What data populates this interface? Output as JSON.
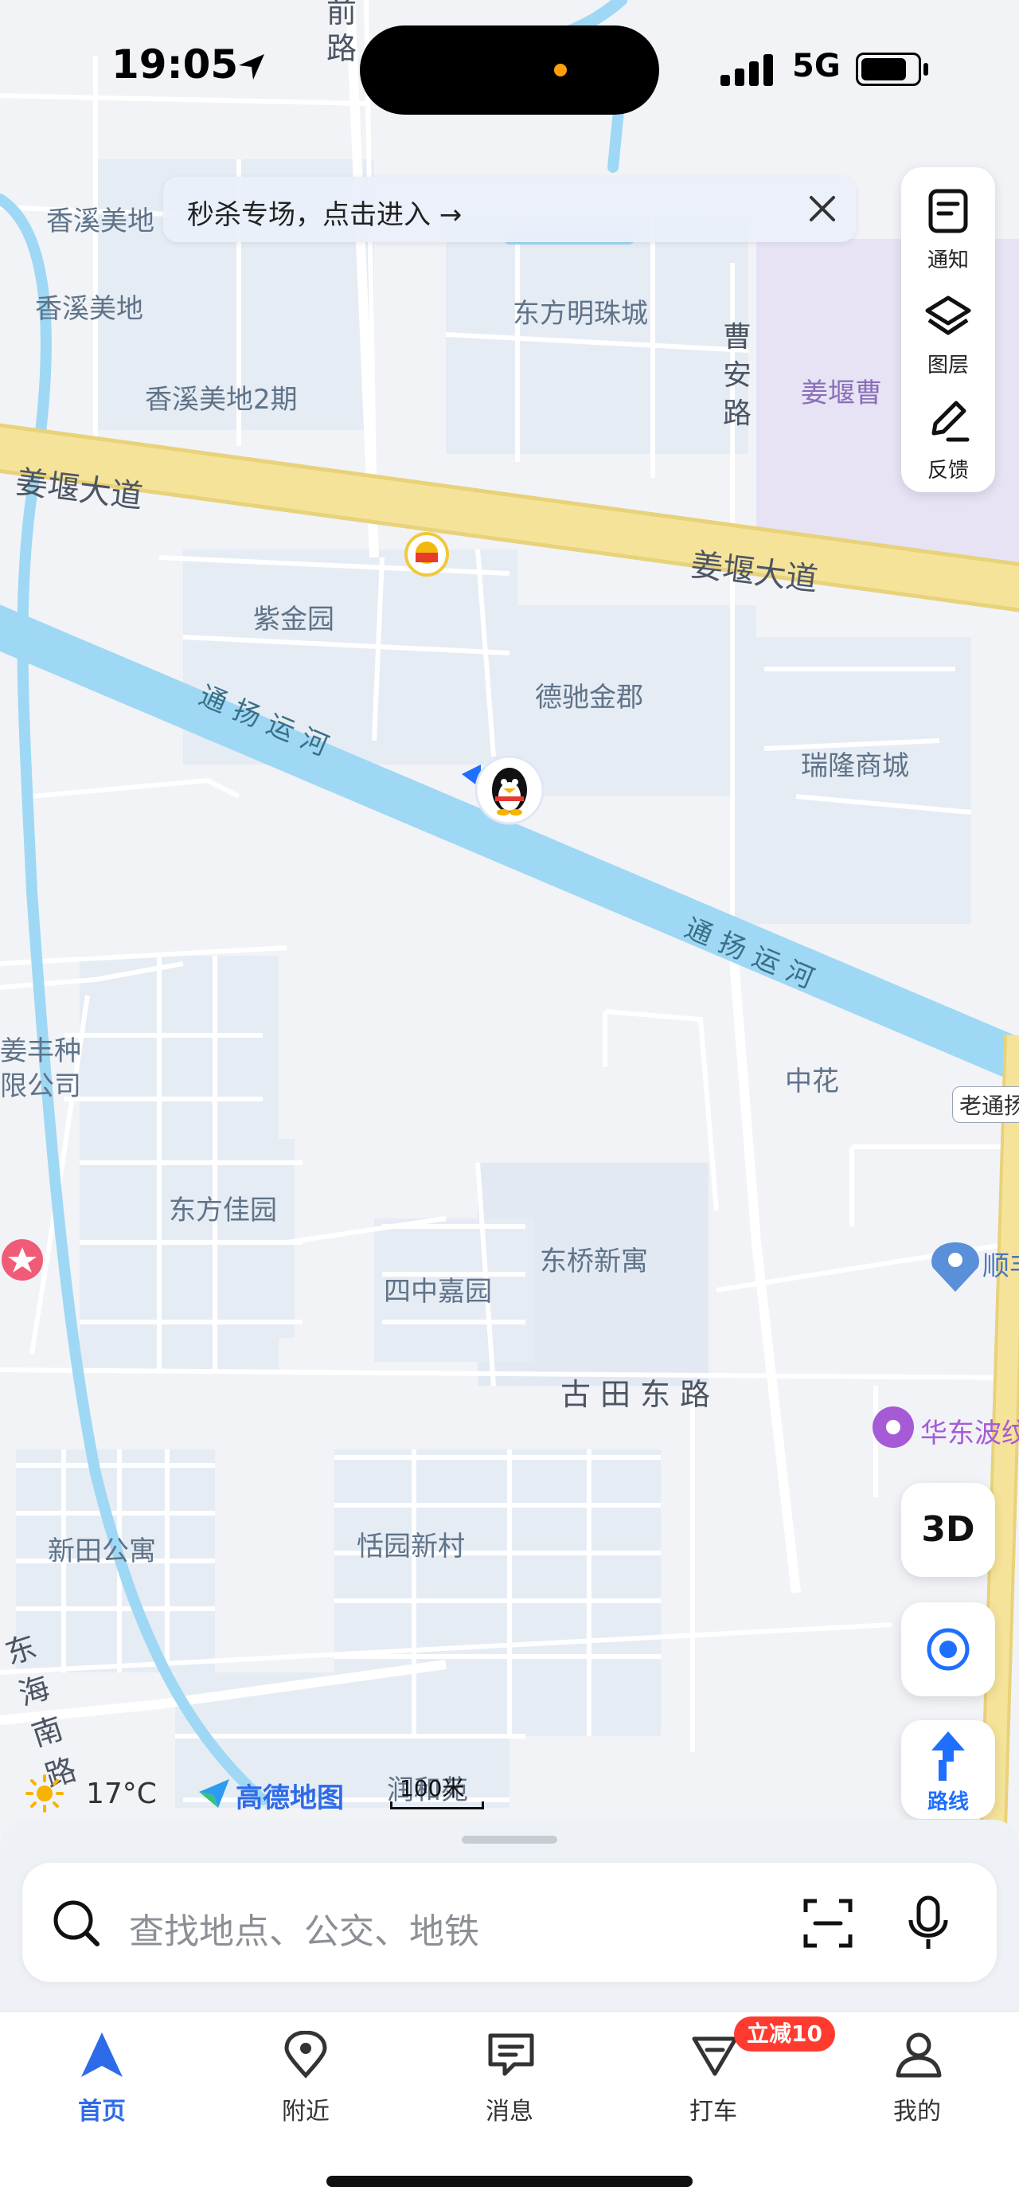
{
  "status_bar": {
    "time": "19:05",
    "network": "5G"
  },
  "banner": {
    "text": "秒杀专场，点击进入 →"
  },
  "tools": [
    {
      "label": "通知",
      "icon": "notification-icon"
    },
    {
      "label": "图层",
      "icon": "layers-icon"
    },
    {
      "label": "反馈",
      "icon": "feedback-icon"
    }
  ],
  "map": {
    "roads": [
      "姜堰大道",
      "姜堰大道",
      "古田东路",
      "东海南路",
      "曹安路",
      "前路"
    ],
    "canals": [
      "通扬运河",
      "通扬运河"
    ],
    "places": {
      "xiangxi1": "香溪美地",
      "xiangxi2": "香溪美地",
      "xiangxi3": "香溪美地2期",
      "dongfang_mingzhu": "东方明珠城",
      "jiangyan_cao": "姜堰曹",
      "zijin": "紫金园",
      "dechi": "德驰金郡",
      "ruilong": "瑞隆商城",
      "zhonghua": "中花",
      "laotong": "老通扬",
      "jiangfeng1": "姜丰种",
      "jiangfeng2": "限公司",
      "dongfang_jiayuan": "东方佳园",
      "dongqiao": "东桥新寓",
      "sizhong": "四中嘉园",
      "shunfeng": "顺丰",
      "huadong": "华东波纹",
      "xintian": "新田公寓",
      "tianyuan": "恬园新村",
      "runhe": "润和苑"
    }
  },
  "controls": {
    "three_d": "3D",
    "route": "路线"
  },
  "weather": {
    "temp": "17°C"
  },
  "brand": {
    "name": "高德地图"
  },
  "scale": {
    "text": "100米"
  },
  "search": {
    "placeholder": "查找地点、公交、地铁"
  },
  "tabs": [
    {
      "label": "首页",
      "active": true
    },
    {
      "label": "附近"
    },
    {
      "label": "消息"
    },
    {
      "label": "打车"
    },
    {
      "label": "我的"
    }
  ],
  "promo": {
    "text": "立减10"
  },
  "colors": {
    "accent": "#2d6be8",
    "river": "#9fd8f4",
    "main_road": "#f6e39a",
    "promo": "#ff3b30"
  }
}
